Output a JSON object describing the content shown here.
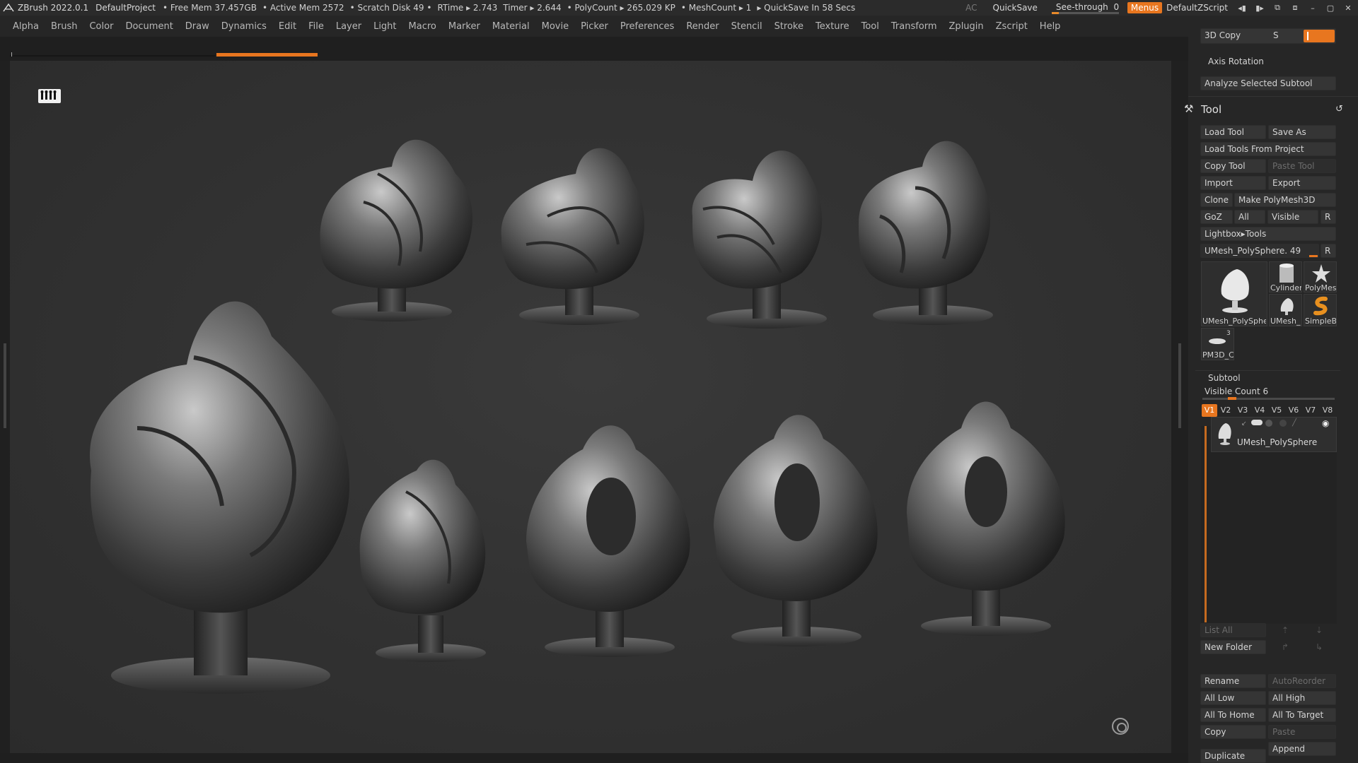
{
  "titlebar": {
    "app": "ZBrush 2022.0.1",
    "project": "DefaultProject",
    "free_mem": "• Free Mem 37.457GB",
    "active_mem": "• Active Mem 2572",
    "scratch": "• Scratch Disk 49 •",
    "rtime": "RTime ▸ 2.743",
    "timer": "Timer ▸ 2.644",
    "polycount": "• PolyCount ▸ 265.029 KP",
    "meshcount": "• MeshCount ▸ 1",
    "quicksave_status": "▸ QuickSave In 58 Secs",
    "ac": "AC",
    "quicksave": "QuickSave",
    "see_through_label": "See-through",
    "see_through_value": "0",
    "menus": "Menus",
    "script": "DefaultZScript"
  },
  "menu": [
    "Alpha",
    "Brush",
    "Color",
    "Document",
    "Draw",
    "Dynamics",
    "Edit",
    "File",
    "Layer",
    "Light",
    "Macro",
    "Marker",
    "Material",
    "Movie",
    "Picker",
    "Preferences",
    "Render",
    "Stencil",
    "Stroke",
    "Texture",
    "Tool",
    "Transform",
    "Zplugin",
    "Zscript",
    "Help"
  ],
  "panel": {
    "copy3d": "3D Copy",
    "s_label": "S",
    "axis_rotation": "Axis Rotation",
    "analyze": "Analyze Selected Subtool",
    "tool_title": "Tool",
    "load_tool": "Load Tool",
    "save_as": "Save As",
    "load_from_project": "Load Tools From Project",
    "copy_tool": "Copy Tool",
    "paste_tool": "Paste Tool",
    "import": "Import",
    "export": "Export",
    "clone": "Clone",
    "make_polymesh": "Make PolyMesh3D",
    "goz": "GoZ",
    "all": "All",
    "visible": "Visible",
    "r": "R",
    "lightbox_tools": "Lightbox▸Tools",
    "current_tool": "UMesh_PolySphere. 49",
    "thumbs": {
      "main": "UMesh_PolySphe",
      "cylinder": "Cylinder",
      "polymesh": "PolyMes",
      "umesh_small": "UMesh_",
      "simpleb": "SimpleB",
      "pm3d": "PM3D_C",
      "pm3d_count": "3"
    },
    "subtool_title": "Subtool",
    "visible_count": "Visible Count 6",
    "vtabs": [
      "V1",
      "V2",
      "V3",
      "V4",
      "V5",
      "V6",
      "V7",
      "V8"
    ],
    "subtool_name": "UMesh_PolySphere",
    "list_all": "List All",
    "new_folder": "New Folder",
    "rename": "Rename",
    "autoreorder": "AutoReorder",
    "all_low": "All Low",
    "all_high": "All High",
    "all_to_home": "All To Home",
    "all_to_target": "All To Target",
    "copy": "Copy",
    "paste": "Paste",
    "append": "Append",
    "duplicate": "Duplicate"
  },
  "colors": {
    "accent": "#e8761f",
    "panel_bg": "#262626",
    "canvas_bg": "#333333"
  }
}
